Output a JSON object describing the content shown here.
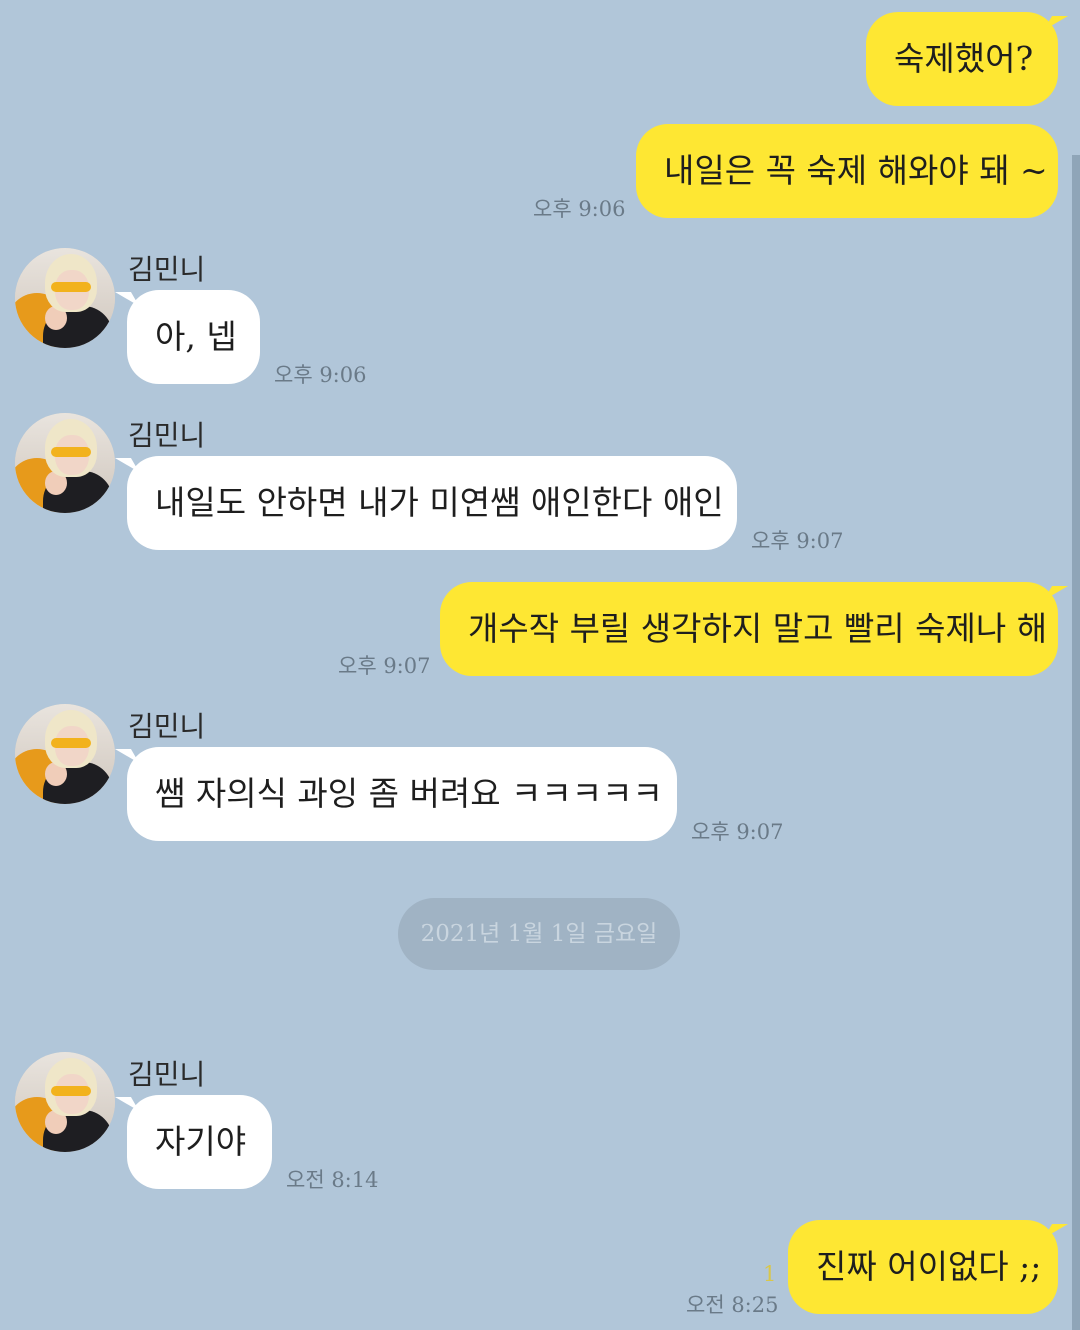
{
  "contact": {
    "name": "김민니"
  },
  "messages": [
    {
      "sender": "me",
      "text": "숙제했어?",
      "time": ""
    },
    {
      "sender": "me",
      "text": "내일은 꼭 숙제 해와야 돼 ~",
      "time": "오후 9:06"
    },
    {
      "sender": "them",
      "name": "김민니",
      "text": "아, 넵",
      "time": "오후 9:06"
    },
    {
      "sender": "them",
      "name": "김민니",
      "text": "내일도 안하면 내가 미연쌤 애인한다 애인",
      "time": "오후 9:07"
    },
    {
      "sender": "me",
      "text": "개수작 부릴 생각하지 말고 빨리 숙제나 해",
      "time": "오후 9:07"
    },
    {
      "sender": "them",
      "name": "김민니",
      "text": "쌤 자의식 과잉 좀 버려요 ㅋㅋㅋㅋㅋ",
      "time": "오후 9:07"
    },
    {
      "sender": "them",
      "name": "김민니",
      "text": "자기야",
      "time": "오전 8:14"
    },
    {
      "sender": "me",
      "text": "진짜 어이없다 ;;",
      "time": "오전 8:25",
      "unread": "1"
    }
  ],
  "date_divider": "2021년 1월 1일 금요일",
  "colors": {
    "background": "#b1c6d9",
    "my_bubble": "#fee733",
    "their_bubble": "#ffffff",
    "time_text": "#6a7a88",
    "unread_count": "#d9c74a"
  },
  "icons": {
    "avatar": "profile-photo-avatar"
  }
}
